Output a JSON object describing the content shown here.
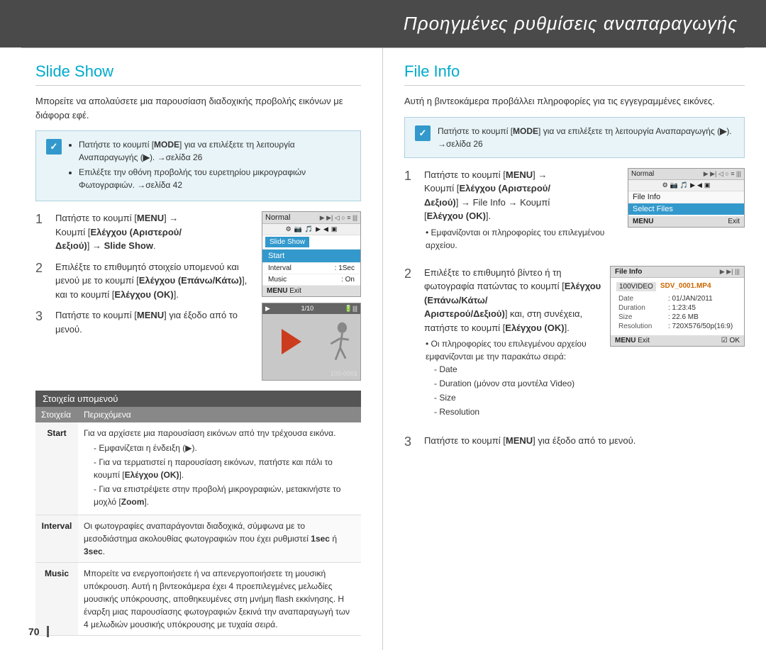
{
  "header": {
    "title": "Προηγμένες ρυθμίσεις αναπαραγωγής"
  },
  "page_number": "70",
  "left": {
    "title": "Slide Show",
    "intro": "Μπορείτε να απολαύσετε μια παρουσίαση διαδοχικής προβολής εικόνων με διάφορα εφέ.",
    "note": {
      "bullets": [
        "Πατήστε το κουμπί [MODE] για να επιλέξετε τη λειτουργία Αναπαραγωγής (▶). →σελίδα 26",
        "Επιλέξτε την οθόνη προβολής του ευρετηρίου μικρογραφιών Φωτογραφιών. →σελίδα 42"
      ]
    },
    "steps": [
      {
        "num": "1",
        "text_parts": [
          "Πατήστε το κουμπί [",
          "MENU",
          "] →",
          " Κουμπί [",
          "Ελέγχου (Αριστερού/Δεξιού)",
          "] → ",
          "Slide Show",
          "."
        ],
        "text_plain": "Πατήστε το κουμπί [MENU] → Κουμπί [Ελέγχου (Αριστερού/Δεξιού)] → Slide Show."
      },
      {
        "num": "2",
        "text_plain": "Επιλέξτε το επιθυμητό στοιχείο υπομενού και μενού με το κουμπί [Ελέγχου (Επάνω/Κάτω)], και το κουμπί [Ελέγχου (ΟΚ)]."
      },
      {
        "num": "3",
        "text_plain": "Πατήστε το κουμπί [MENU] για έξοδο από το μενού."
      }
    ],
    "cam_ui": {
      "title": "Normal",
      "icons": "▶ ⚙ ◀ ○ ≡",
      "menu_items": [
        "Slide Show"
      ],
      "submenu": [
        {
          "label": "Start",
          "selected": true
        },
        {
          "label": "Interval",
          "value": ": 1Sec"
        },
        {
          "label": "Music",
          "value": ": On"
        }
      ],
      "footer": "MENU  Exit"
    },
    "table_section": {
      "title": "Στοιχεία υπομενού",
      "col_headers": [
        "Στοιχεία",
        "Περιεχόμενα"
      ],
      "rows": [
        {
          "label": "Start",
          "content": "Για να αρχίσετε μια παρουσίαση εικόνων από την τρέχουσα εικόνα.\n- Εμφανίζεται η ένδειξη (▶).\n- Για να τερματιστεί η παρουσίαση εικόνων, πατήστε και πάλι το κουμπί [Ελέγχου (ΟΚ)].\n- Για να επιστρέψετε στην προβολή μικρογραφιών, μετακινήστε το μοχλό [Zoom]."
        },
        {
          "label": "Interval",
          "content": "Οι φωτογραφίες αναπαράγονται διαδοχικά, σύμφωνα με το μεσοδιάστημα ακολουθίας φωτογραφιών που έχει ρυθμιστεί 1sec ή 3sec."
        },
        {
          "label": "Music",
          "content": "Μπορείτε να ενεργοποιήσετε ή να απενεργοποιήσετε τη μουσική υπόκρουση. Αυτή η βιντεοκάμερα έχει 4 προεπιλεγμένες μελωδίες μουσικής υπόκρουσης, αποθηκευμένες στη μνήμη flash εκκίνησης. Η έναρξη μιας παρουσίασης φωτογραφιών ξεκινά την αναπαραγωγή των 4 μελωδιών μουσικής υπόκρουσης με τυχαία σειρά."
        }
      ]
    }
  },
  "right": {
    "title": "File Info",
    "intro": "Αυτή η βιντεοκάμερα προβάλλει πληροφορίες για τις εγγεγραμμένες εικόνες.",
    "note": {
      "text": "Πατήστε το κουμπί [MODE] για να επιλέξετε τη λειτουργία Αναπαραγωγής (▶). →σελίδα 26"
    },
    "steps": [
      {
        "num": "1",
        "text_plain": "Πατήστε το κουμπί [MENU] → Κουμπί [Ελέγχου (Αριστερού/Δεξιού)] → File Info → Κουμπί [Ελέγχου (ΟΚ)].",
        "sub": "Εμφανίζονται οι πληροφορίες του επιλεγμένου αρχείου."
      },
      {
        "num": "2",
        "text_plain": "Επιλέξτε το επιθυμητό βίντεο ή τη φωτογραφία πατώντας το κουμπί [Ελέγχου (Επάνω/Κάτω/Αριστερού/Δεξιού)] και, στη συνέχεια, πατήστε το κουμπί [Ελέγχου (ΟΚ)].",
        "sub_list": [
          "Οι πληροφορίες του επιλεγμένου αρχείου εμφανίζονται με την παρακάτω σειρά:",
          "Date",
          "Duration (μόνον στα μοντέλα Video)",
          "Size",
          "Resolution"
        ]
      },
      {
        "num": "3",
        "text_plain": "Πατήστε το κουμπί [MENU] για έξοδο από το μενού."
      }
    ],
    "cam_ui_1": {
      "title": "Normal",
      "menu_items": [
        "File Info"
      ],
      "selected_item": "Select Files",
      "footer_left": "MENU",
      "footer_right": "Exit"
    },
    "file_info_box": {
      "title": "File Info",
      "folder": "100VIDEO",
      "filename": "SDV_0001.MP4",
      "rows": [
        {
          "label": "Date",
          "value": ": 01/JAN/2011"
        },
        {
          "label": "Duration",
          "value": ": 1:23:45"
        },
        {
          "label": "Size",
          "value": ": 22.6 MB"
        },
        {
          "label": "Resolution",
          "value": ": 720X576/50p(16:9)"
        }
      ],
      "footer_left": "MENU  Exit",
      "footer_right": "☑ OK"
    }
  }
}
